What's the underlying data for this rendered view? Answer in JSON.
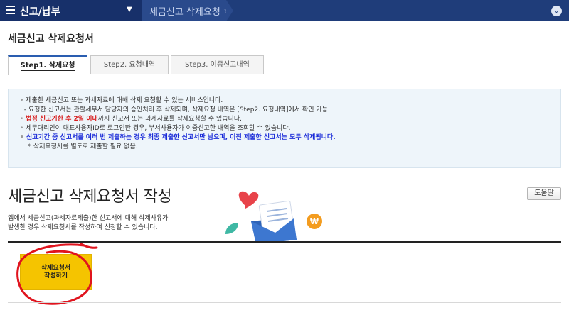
{
  "topbar": {
    "menu_title": "신고/납부",
    "breadcrumb": "세금신고 삭제요청",
    "icons": [
      "hamburger-icon",
      "caret-down-icon",
      "star-icon",
      "chevron-down-icon"
    ]
  },
  "page": {
    "title": "세금신고 삭제요청서"
  },
  "tabs": [
    {
      "label": "Step1. 삭제요청",
      "active": true
    },
    {
      "label": "Step2. 요청내역",
      "active": false
    },
    {
      "label": "Step3. 이중신고내역",
      "active": false
    }
  ],
  "info": {
    "line1": "제출한 세금신고 또는 과세자료에 대해 삭제 요청할 수 있는 서비스입니다.",
    "line2": "- 요청한 신고서는 관할세무서 담당자의 승인처리 후 삭제되며, 삭제요청 내역은 [Step2. 요청내역]에서 확인 가능",
    "line3_red": "법정 신고기한 후 2일 이내",
    "line3_rest": "까지 신고서 또는 과세자료를 삭제요청할 수 있습니다.",
    "line4": "세무대리인이 대표사용자ID로 로그인한 경우, 부서사용자가 이중신고한 내역을 조회할 수 있습니다.",
    "line5": "신고기간 중 신고서를 여러 번 제출하는 경우 최종 제출한 신고서만 남으며, 이전 제출한 신고서는 모두 삭제됩니다.",
    "line6": "* 삭제요청서를 별도로 제출할 필요 없음."
  },
  "section": {
    "heading": "세금신고 삭제요청서 작성",
    "help_label": "도움말",
    "desc_line1": "앱에서 세금신고(과세자료제출)한 신고서에 대해 삭제사유가",
    "desc_line2": "발생한 경우 삭제요청서를 작성하여 신청할 수 있습니다."
  },
  "create_button": {
    "line1": "삭제요청서",
    "line2": "작성하기"
  },
  "colors": {
    "nav": "#1f3d7a",
    "accent_yellow": "#f5c400",
    "red": "#d81e1e",
    "blue": "#1a2bd8",
    "info_bg": "#eef5fa"
  }
}
